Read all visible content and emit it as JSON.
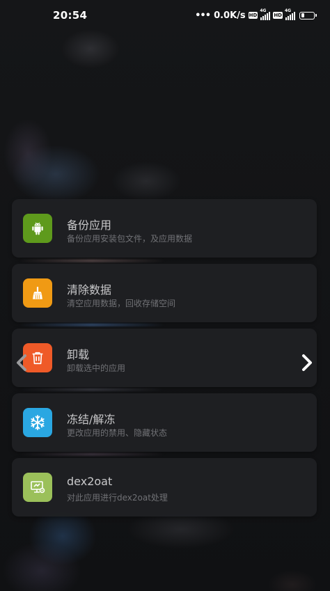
{
  "status_bar": {
    "time": "20:54",
    "dots": "•••",
    "net_speed": "0.0K/s",
    "hd1": "HD",
    "hd2": "HD",
    "lte1": "4G",
    "lte2": "4G",
    "battery_level": 0.25
  },
  "menu": {
    "items": [
      {
        "title": "备份应用",
        "subtitle": "备份应用安装包文件，及应用数据",
        "icon": "android-icon",
        "color": "#5e9a1c"
      },
      {
        "title": "清除数据",
        "subtitle": "清空应用数据，回收存储空间",
        "icon": "broom-icon",
        "color": "#f09a14"
      },
      {
        "title": "卸载",
        "subtitle": "卸载选中的应用",
        "icon": "trash-icon",
        "color": "#ef5a28"
      },
      {
        "title": "冻结/解冻",
        "subtitle": "更改应用的禁用、隐藏状态",
        "icon": "snowflake-icon",
        "color": "#2aa7e2"
      },
      {
        "title": "dex2oat",
        "subtitle": "对此应用进行dex2oat处理",
        "icon": "monitor-settings-icon",
        "color": "#9bc05a"
      }
    ]
  },
  "nav": {
    "left": "chevron-left-icon",
    "right": "chevron-right-icon"
  }
}
